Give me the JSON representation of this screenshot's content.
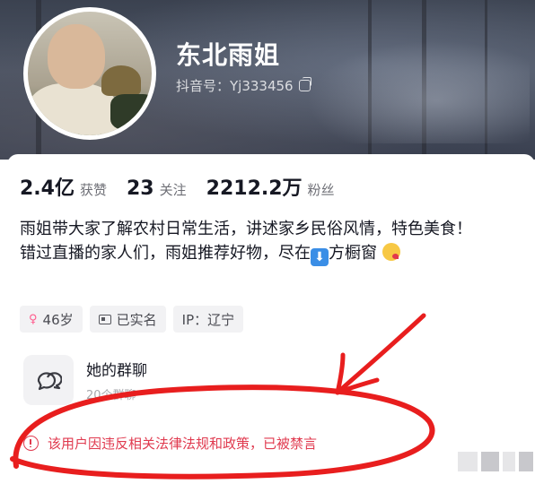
{
  "profile": {
    "name": "东北雨姐",
    "douyin_id": "抖音号：Yj333456"
  },
  "stats": [
    {
      "value": "2.4亿",
      "label": "获赞"
    },
    {
      "value": "23",
      "label": "关注"
    },
    {
      "value": "2212.2万",
      "label": "粉丝"
    }
  ],
  "bio": {
    "line1": "雨姐带大家了解农村日常生活，讲述家乡民俗风情，特色美食！",
    "line2_prefix": "错过直播的家人们，雨姐推荐好物，尽在",
    "line2_suffix": "方橱窗",
    "emoji_down": "⬇",
    "emoji_face": "kissing-face"
  },
  "tags": [
    {
      "text": "46岁",
      "icon": "female-icon"
    },
    {
      "text": "已实名",
      "icon": "id-card-icon"
    },
    {
      "text": "IP：辽宁",
      "icon": ""
    }
  ],
  "group_chat": {
    "title": "她的群聊",
    "subtitle": "20个群聊"
  },
  "banned_notice": "该用户因违反相关法律法规和政策，已被禁言",
  "colors": {
    "warning": "#e03a4f",
    "annotation": "#e81e1e",
    "text_primary": "#161823",
    "text_secondary": "#6e6f76"
  }
}
